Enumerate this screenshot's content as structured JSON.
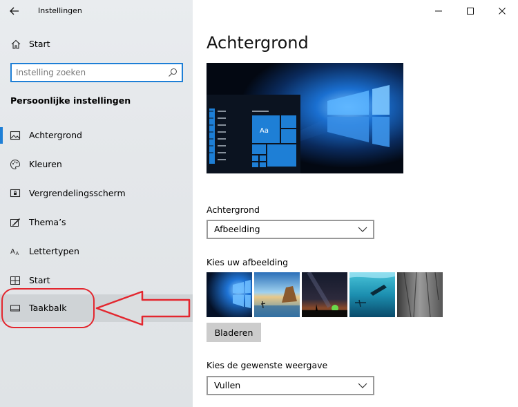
{
  "app": {
    "title": "Instellingen"
  },
  "sidebar": {
    "home_label": "Start",
    "search_placeholder": "Instelling zoeken",
    "section_title": "Persoonlijke instellingen",
    "items": [
      {
        "label": "Achtergrond",
        "icon": "picture-icon",
        "selected": true
      },
      {
        "label": "Kleuren",
        "icon": "palette-icon"
      },
      {
        "label": "Vergrendelingsscherm",
        "icon": "lock-screen-icon"
      },
      {
        "label": "Thema’s",
        "icon": "brush-icon"
      },
      {
        "label": "Lettertypen",
        "icon": "font-icon"
      },
      {
        "label": "Start",
        "icon": "start-tiles-icon"
      },
      {
        "label": "Taakbalk",
        "icon": "taskbar-icon",
        "highlighted": true
      }
    ]
  },
  "main": {
    "title": "Achtergrond",
    "preview_tile_text": "Aa",
    "background_label": "Achtergrond",
    "background_value": "Afbeelding",
    "choose_picture_label": "Kies uw afbeelding",
    "browse_label": "Bladeren",
    "fit_label": "Kies de gewenste weergave",
    "fit_value": "Vullen"
  },
  "colors": {
    "accent": "#1e7fd6",
    "annotation": "#e3262e"
  }
}
